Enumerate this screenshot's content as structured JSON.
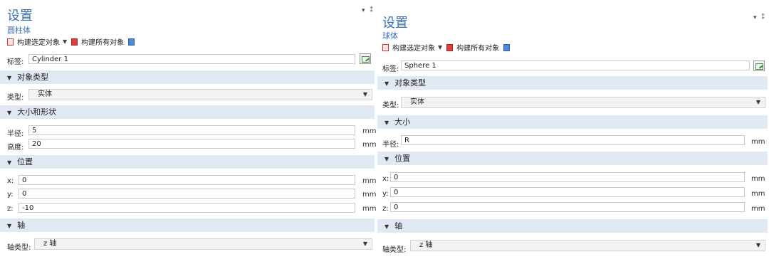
{
  "left": {
    "title": "设置",
    "subtitle": "圆柱体",
    "pin_buttons": "▾ ⁑",
    "toolbar": {
      "build_selected": "构建选定对象",
      "build_all": "构建所有对象"
    },
    "label_field": {
      "label": "标签:",
      "value": "Cylinder 1"
    },
    "sections": {
      "object_type": "对象类型",
      "size_shape": "大小和形状",
      "position": "位置",
      "axis": "轴"
    },
    "type": {
      "label": "类型:",
      "value": "实体"
    },
    "radius": {
      "label": "半径:",
      "value": "5",
      "unit": "mm"
    },
    "height": {
      "label": "高度:",
      "value": "20",
      "unit": "mm"
    },
    "x": {
      "label": "x:",
      "value": "0",
      "unit": "mm"
    },
    "y": {
      "label": "y:",
      "value": "0",
      "unit": "mm"
    },
    "z": {
      "label": "z:",
      "value": "-10",
      "unit": "mm"
    },
    "axis_type": {
      "label": "轴类型:",
      "value": "z 轴"
    }
  },
  "right": {
    "title": "设置",
    "subtitle": "球体",
    "pin_buttons": "▾ ⁑",
    "toolbar": {
      "build_selected": "构建选定对象",
      "build_all": "构建所有对象"
    },
    "label_field": {
      "label": "标签:",
      "value": "Sphere 1"
    },
    "sections": {
      "object_type": "对象类型",
      "size": "大小",
      "position": "位置",
      "axis": "轴"
    },
    "type": {
      "label": "类型:",
      "value": "实体"
    },
    "radius": {
      "label": "半径:",
      "value": "R",
      "unit": "mm"
    },
    "x": {
      "label": "x:",
      "value": "0",
      "unit": "mm"
    },
    "y": {
      "label": "y:",
      "value": "0",
      "unit": "mm"
    },
    "z": {
      "label": "z:",
      "value": "0",
      "unit": "mm"
    },
    "axis_type": {
      "label": "轴类型:",
      "value": "z 轴"
    }
  },
  "colors": {
    "title_blue": "#3a6fb6",
    "section_bg": "#dfe8f3",
    "build_icon_red": "#d94040",
    "build_icon_blue": "#4a8ad8"
  },
  "icons": [
    "build-selected-icon",
    "build-all-icon",
    "build-options-icon",
    "edit-label-icon",
    "chevron-down-icon",
    "collapse-triangle-icon"
  ]
}
